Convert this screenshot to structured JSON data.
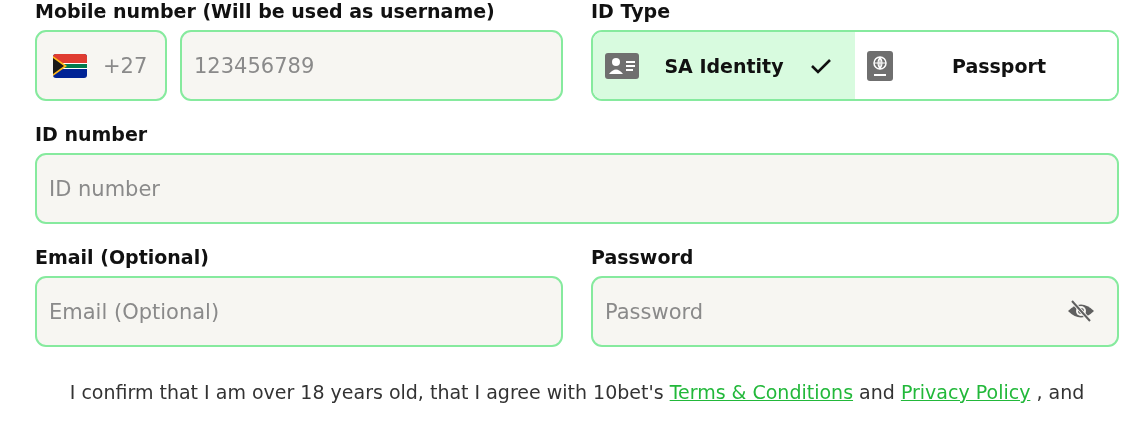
{
  "mobile": {
    "label": "Mobile number (Will be used as username)",
    "country_code": "+27",
    "placeholder": "123456789"
  },
  "id_type": {
    "label": "ID Type",
    "options": [
      {
        "label": "SA Identity",
        "kind": "identity",
        "selected": true
      },
      {
        "label": "Passport",
        "kind": "passport",
        "selected": false
      }
    ]
  },
  "id_number": {
    "label": "ID number",
    "placeholder": "ID number"
  },
  "email": {
    "label": "Email (Optional)",
    "placeholder": "Email (Optional)"
  },
  "password": {
    "label": "Password",
    "placeholder": "Password"
  },
  "consent": [
    {
      "kind": "text",
      "text": "I confirm that I am over 18 years old, that I agree with 10bet's"
    },
    {
      "kind": "link",
      "text": "Terms & Conditions"
    },
    {
      "kind": "text",
      "text": "and"
    },
    {
      "kind": "link",
      "text": "Privacy Policy"
    },
    {
      "kind": "text",
      "text": ", and"
    }
  ]
}
